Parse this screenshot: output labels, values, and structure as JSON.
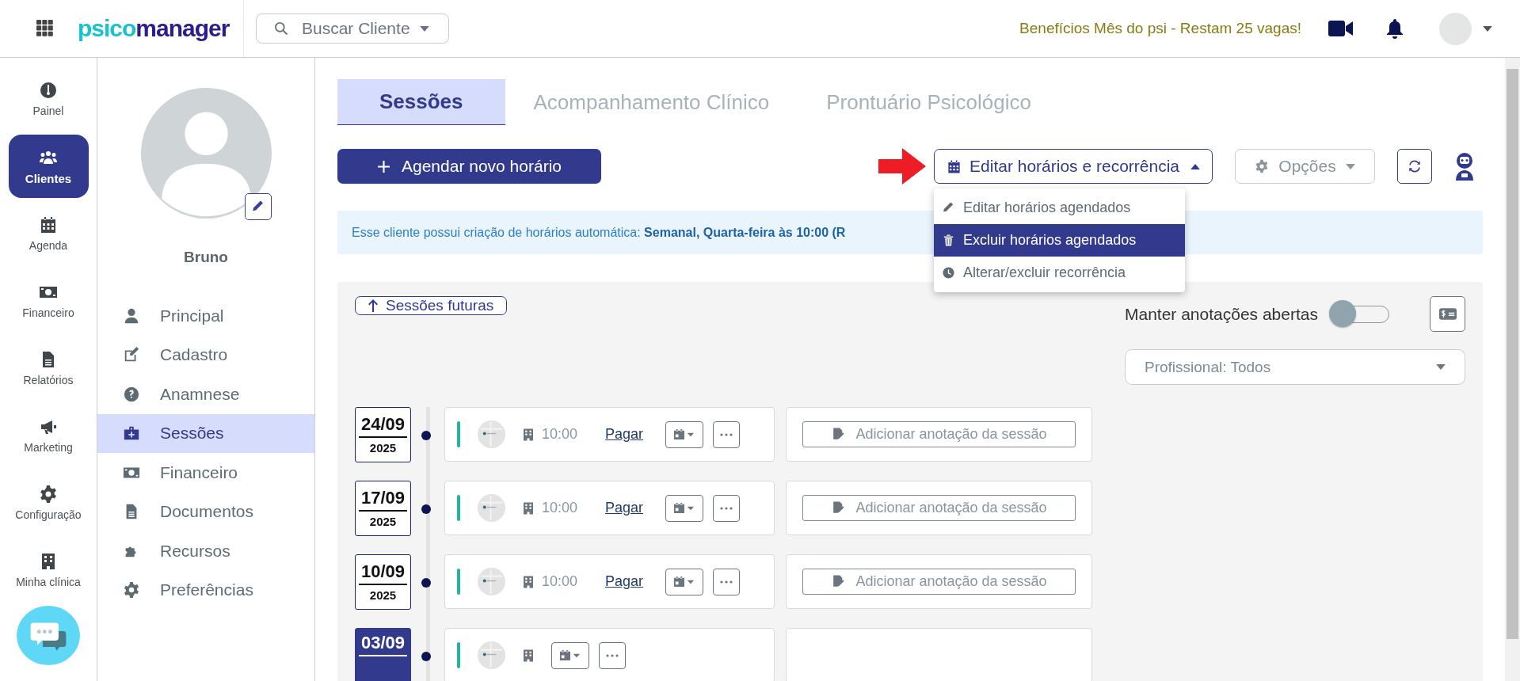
{
  "top_bar": {
    "logo_parts": [
      "psico",
      "manager"
    ],
    "search": {
      "placeholder": "Buscar Cliente"
    },
    "promo": "Benefícios Mês do psi - Restam 25 vagas!"
  },
  "nav_rail": [
    {
      "label": "Painel",
      "selected": false
    },
    {
      "label": "Clientes",
      "selected": true
    },
    {
      "label": "Agenda",
      "selected": false
    },
    {
      "label": "Financeiro",
      "selected": false
    },
    {
      "label": "Relatórios",
      "selected": false
    },
    {
      "label": "Marketing",
      "selected": false
    },
    {
      "label": "Configuração",
      "selected": false
    },
    {
      "label": "Minha clínica",
      "selected": false
    }
  ],
  "client": {
    "name": "Bruno"
  },
  "client_menu": [
    {
      "label": "Principal",
      "selected": false
    },
    {
      "label": "Cadastro",
      "selected": false
    },
    {
      "label": "Anamnese",
      "selected": false
    },
    {
      "label": "Sessões",
      "selected": true
    },
    {
      "label": "Financeiro",
      "selected": false
    },
    {
      "label": "Documentos",
      "selected": false
    },
    {
      "label": "Recursos",
      "selected": false
    },
    {
      "label": "Preferências",
      "selected": false
    }
  ],
  "tabs": [
    {
      "label": "Sessões",
      "selected": true
    },
    {
      "label": "Acompanhamento Clínico",
      "selected": false
    },
    {
      "label": "Prontuário Psicológico",
      "selected": false
    }
  ],
  "actions": {
    "new_button": "Agendar novo horário",
    "schedule_menu": {
      "label": "Editar horários e recorrência",
      "expanded": true,
      "items": [
        {
          "label": "Editar horários agendados",
          "selected": false
        },
        {
          "label": "Excluir horários agendados",
          "selected": true
        },
        {
          "label": "Alterar/excluir recorrência",
          "selected": false
        }
      ]
    },
    "options_button": "Opções"
  },
  "banner": "Esse cliente possui criação de horários automática: **Semanal, Quarta-feira às 10:00 (R**",
  "sessions_panel": {
    "future_button": "Sessões futuras",
    "keep_notes": {
      "label": "Manter anotações abertas",
      "on": false
    },
    "professional_select": {
      "value": "Profissional: Todos"
    },
    "sessions": [
      {
        "date": "24/09",
        "year": "2025",
        "selected": false,
        "time": "10:00",
        "pay_link": "Pagar",
        "note_button": "Adicionar anotação da sessão"
      },
      {
        "date": "17/09",
        "year": "2025",
        "selected": false,
        "time": "10:00",
        "pay_link": "Pagar",
        "note_button": "Adicionar anotação da sessão"
      },
      {
        "date": "10/09",
        "year": "2025",
        "selected": false,
        "time": "10:00",
        "pay_link": "Pagar",
        "note_button": "Adicionar anotação da sessão"
      },
      {
        "date": "03/09",
        "selected": true
      }
    ]
  }
}
